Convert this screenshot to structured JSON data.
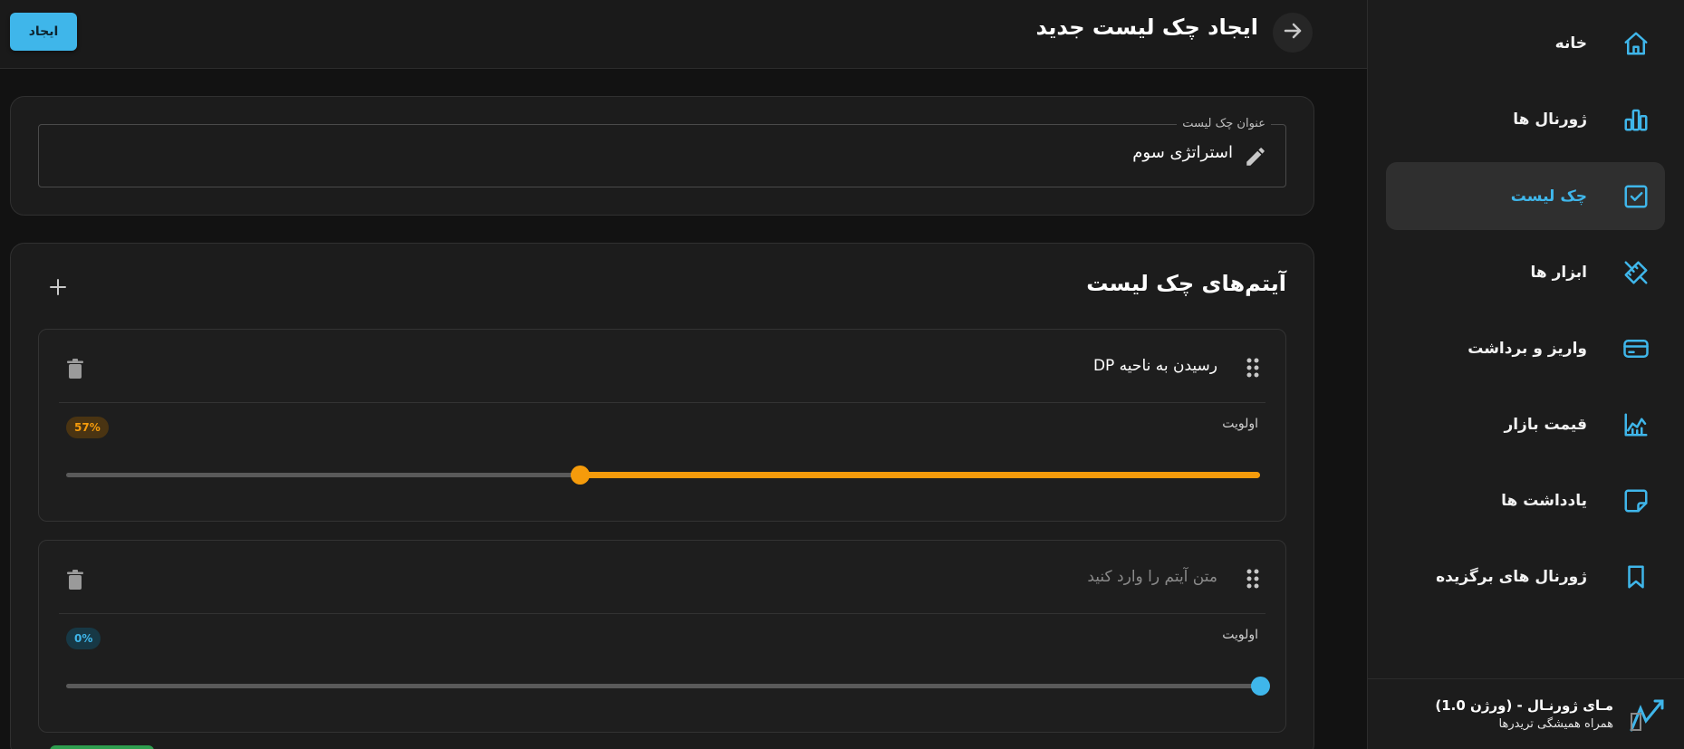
{
  "header": {
    "title": "ایجاد چک لیست جدید",
    "create_button": "ایجاد"
  },
  "sidebar": {
    "items": [
      {
        "label": "خانه",
        "icon": "home-icon"
      },
      {
        "label": "ژورنال ها",
        "icon": "bar-chart-icon"
      },
      {
        "label": "چک لیست",
        "icon": "checkbox-icon",
        "active": true
      },
      {
        "label": "ابزار ها",
        "icon": "tools-icon"
      },
      {
        "label": "واریز و برداشت",
        "icon": "credit-card-icon"
      },
      {
        "label": "قیمت بازار",
        "icon": "area-chart-icon"
      },
      {
        "label": "یادداشت ها",
        "icon": "note-icon"
      },
      {
        "label": "ژورنال های برگزیده",
        "icon": "bookmark-icon"
      }
    ],
    "footer": {
      "title": "مـای ژورنـال - (ورژن 1.0)",
      "subtitle": "همراه همیشگی تریدرها"
    }
  },
  "title_field": {
    "label": "عنوان چک لیست",
    "value": "استراتژی سوم"
  },
  "items_section": {
    "title": "آیتم‌های چک لیست",
    "items": [
      {
        "text": "رسیدن به ناحیه DP",
        "priority_label": "اولویت",
        "priority_value": "57%",
        "priority": 0.57,
        "color": "#f59b0b"
      },
      {
        "text": "",
        "placeholder": "متن آیتم را وارد کنید",
        "priority_label": "اولویت",
        "priority_value": "0%",
        "priority": 0.0,
        "color": "#3fb6ea"
      }
    ]
  },
  "colors": {
    "accent": "#3fb6ea",
    "warning": "#f59b0b"
  }
}
